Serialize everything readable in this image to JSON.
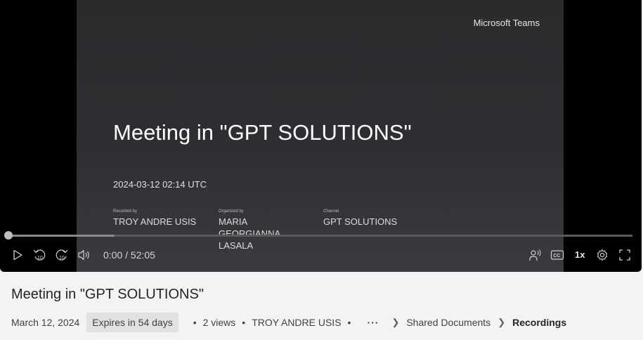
{
  "video": {
    "brand": "Microsoft Teams",
    "slide_title": "Meeting in \"GPT SOLUTIONS\"",
    "slide_date": "2024-03-12 02:14 UTC",
    "meta": [
      {
        "label": "Recorded by",
        "value": "TROY ANDRE USIS"
      },
      {
        "label": "Organized by",
        "value": "MARIA GEORGIANNA LASALA"
      },
      {
        "label": "Channel",
        "value": "GPT SOLUTIONS"
      }
    ]
  },
  "player": {
    "time": "0:00 / 52:05",
    "speed": "1x",
    "progress_fraction": 0,
    "buffered_fraction": 0.17,
    "controls": {
      "play": "play-icon",
      "rewind": "rewind-10-icon",
      "forward": "forward-10-icon",
      "volume": "volume-icon",
      "audio_description": "audio-description-icon",
      "captions": "closed-captions-icon",
      "settings": "gear-icon",
      "fullscreen": "fullscreen-icon"
    }
  },
  "details": {
    "title": "Meeting in \"GPT SOLUTIONS\"",
    "date": "March 12, 2024",
    "expires": "Expires in 54 days",
    "views": "2 views",
    "owner": "TROY ANDRE USIS",
    "more": "···",
    "breadcrumb": [
      "Shared Documents",
      "Recordings"
    ]
  },
  "colors": {
    "player_bg": "#000000",
    "slide_bg": "#2f2f33",
    "page_bg": "#f3f3f3"
  }
}
